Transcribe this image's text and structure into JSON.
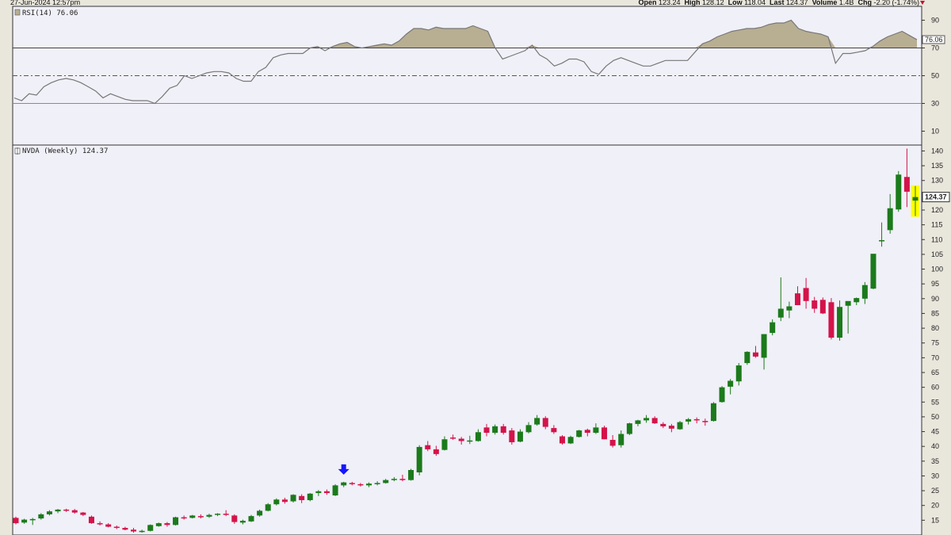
{
  "header": {
    "date": "27-Jun-2024 12:57pm",
    "open_label": "Open",
    "open": "123.24",
    "high_label": "High",
    "high": "128.12",
    "low_label": "Low",
    "low": "118.04",
    "last_label": "Last",
    "last": "124.37",
    "volume_label": "Volume",
    "volume": "1.4B",
    "chg_label": "Chg",
    "chg": "-2.20 (-1.74%)"
  },
  "colors": {
    "up": "#1b7a1b",
    "down": "#d4134a",
    "rsi_line": "#777777",
    "rsi_fill": "#b8ae92",
    "panel_bg": "#f0f0f8",
    "last_highlight": "#ffff00",
    "arrow": "#1515ff"
  },
  "chart_data": [
    {
      "type": "line",
      "title": "RSI(14) 76.06",
      "ylim": [
        0,
        100
      ],
      "yticks": [
        10,
        30,
        50,
        70,
        90
      ],
      "reference_lines": [
        30,
        50,
        70
      ],
      "last_value_label": "76.06",
      "values": [
        34,
        32,
        37,
        36,
        42,
        45,
        47,
        48,
        47,
        45,
        42,
        39,
        34,
        37,
        35,
        33,
        32,
        32,
        32,
        30,
        35,
        41,
        43,
        50,
        48,
        50,
        52,
        53,
        53,
        52,
        48,
        46,
        46,
        53,
        56,
        63,
        65,
        66,
        66,
        66,
        70,
        71,
        68,
        71,
        73,
        74,
        71,
        70,
        71,
        72,
        73,
        72,
        75,
        80,
        84,
        84,
        83,
        85,
        84,
        84,
        84,
        84,
        86,
        84,
        82,
        70,
        62,
        64,
        66,
        68,
        72,
        65,
        62,
        57,
        59,
        62,
        62,
        60,
        53,
        51,
        57,
        61,
        63,
        61,
        59,
        57,
        57,
        59,
        61,
        61,
        61,
        61,
        67,
        73,
        75,
        78,
        80,
        82,
        83,
        84,
        84,
        85,
        87,
        88,
        88,
        90,
        84,
        82,
        81,
        80,
        78,
        59,
        66,
        66,
        67,
        68,
        71,
        75,
        78,
        80,
        82,
        79,
        76
      ]
    },
    {
      "type": "candlestick",
      "title": "NVDA (Weekly) 124.37",
      "ylim": [
        10,
        142
      ],
      "yticks": [
        15,
        20,
        25,
        30,
        35,
        40,
        45,
        50,
        55,
        60,
        65,
        70,
        75,
        80,
        85,
        90,
        95,
        100,
        105,
        110,
        115,
        120,
        125,
        130,
        135,
        140
      ],
      "last_price_label": "124.37",
      "marker": {
        "type": "down-arrow",
        "index": 39
      },
      "ohlc": [
        [
          15.8,
          16.2,
          13.6,
          14.0
        ],
        [
          14.2,
          15.5,
          13.8,
          15.2
        ],
        [
          15.0,
          15.8,
          13.4,
          15.4
        ],
        [
          15.6,
          17.4,
          15.2,
          17.0
        ],
        [
          17.0,
          18.4,
          16.6,
          18.0
        ],
        [
          18.0,
          18.8,
          17.4,
          18.6
        ],
        [
          18.6,
          18.9,
          17.8,
          18.2
        ],
        [
          18.4,
          18.8,
          17.2,
          17.6
        ],
        [
          17.6,
          17.8,
          16.4,
          16.8
        ],
        [
          16.2,
          16.6,
          13.8,
          14.0
        ],
        [
          14.0,
          14.6,
          13.2,
          13.6
        ],
        [
          13.6,
          14.0,
          12.6,
          12.8
        ],
        [
          12.8,
          13.2,
          12.0,
          12.4
        ],
        [
          12.4,
          12.8,
          11.6,
          11.8
        ],
        [
          11.8,
          12.4,
          10.8,
          11.2
        ],
        [
          11.2,
          11.8,
          10.8,
          11.4
        ],
        [
          11.4,
          13.6,
          11.2,
          13.4
        ],
        [
          13.0,
          14.2,
          12.8,
          14.0
        ],
        [
          14.0,
          14.4,
          12.8,
          13.4
        ],
        [
          13.4,
          16.2,
          13.2,
          16.0
        ],
        [
          16.0,
          16.6,
          15.2,
          15.6
        ],
        [
          15.8,
          16.8,
          15.6,
          16.6
        ],
        [
          16.4,
          17.0,
          15.6,
          16.2
        ],
        [
          16.2,
          17.2,
          15.8,
          16.8
        ],
        [
          16.8,
          17.4,
          16.4,
          17.2
        ],
        [
          17.2,
          18.4,
          16.4,
          16.8
        ],
        [
          16.6,
          17.0,
          13.8,
          14.4
        ],
        [
          14.2,
          15.2,
          13.6,
          14.8
        ],
        [
          14.6,
          16.8,
          14.4,
          16.4
        ],
        [
          16.6,
          18.6,
          16.2,
          18.2
        ],
        [
          18.2,
          20.8,
          18.0,
          20.4
        ],
        [
          20.4,
          22.4,
          20.0,
          22.0
        ],
        [
          22.0,
          22.6,
          20.6,
          21.2
        ],
        [
          21.4,
          23.8,
          21.0,
          23.6
        ],
        [
          23.2,
          23.8,
          20.8,
          21.8
        ],
        [
          21.8,
          24.2,
          21.4,
          24.0
        ],
        [
          24.2,
          25.2,
          23.2,
          24.8
        ],
        [
          24.8,
          25.4,
          23.6,
          24.2
        ],
        [
          23.4,
          27.2,
          23.2,
          26.8
        ],
        [
          26.8,
          28.0,
          26.2,
          27.8
        ],
        [
          27.6,
          28.0,
          26.8,
          27.2
        ],
        [
          27.2,
          27.6,
          26.4,
          26.8
        ],
        [
          26.8,
          27.8,
          26.2,
          27.4
        ],
        [
          27.4,
          28.2,
          26.8,
          27.6
        ],
        [
          27.6,
          29.0,
          27.4,
          28.6
        ],
        [
          28.6,
          29.6,
          28.2,
          29.0
        ],
        [
          29.0,
          30.4,
          28.2,
          28.6
        ],
        [
          28.6,
          32.4,
          28.4,
          32.0
        ],
        [
          31.2,
          40.4,
          30.2,
          39.8
        ],
        [
          40.4,
          41.8,
          38.4,
          39.0
        ],
        [
          39.0,
          40.2,
          36.8,
          37.4
        ],
        [
          38.8,
          43.4,
          38.6,
          42.4
        ],
        [
          43.0,
          44.0,
          42.2,
          42.6
        ],
        [
          42.6,
          43.2,
          40.6,
          41.8
        ],
        [
          42.0,
          43.6,
          40.8,
          42.0
        ],
        [
          41.8,
          45.8,
          41.6,
          44.8
        ],
        [
          46.4,
          47.6,
          43.4,
          44.6
        ],
        [
          44.6,
          47.4,
          44.0,
          46.8
        ],
        [
          46.8,
          47.6,
          44.0,
          44.6
        ],
        [
          45.4,
          46.2,
          40.6,
          41.4
        ],
        [
          41.6,
          45.8,
          41.4,
          45.0
        ],
        [
          44.8,
          48.2,
          44.4,
          47.2
        ],
        [
          47.4,
          50.6,
          47.0,
          49.6
        ],
        [
          49.6,
          50.2,
          45.8,
          46.6
        ],
        [
          46.2,
          47.2,
          44.2,
          44.8
        ],
        [
          43.4,
          43.8,
          40.6,
          41.0
        ],
        [
          41.0,
          43.6,
          40.8,
          43.2
        ],
        [
          43.2,
          45.6,
          43.0,
          45.4
        ],
        [
          45.6,
          46.0,
          43.4,
          44.6
        ],
        [
          44.6,
          47.8,
          44.2,
          46.4
        ],
        [
          46.4,
          47.0,
          42.4,
          42.4
        ],
        [
          42.2,
          43.8,
          39.6,
          40.2
        ],
        [
          40.4,
          45.4,
          39.6,
          44.2
        ],
        [
          44.2,
          48.0,
          43.8,
          47.8
        ],
        [
          47.6,
          49.0,
          46.8,
          48.8
        ],
        [
          48.8,
          50.6,
          48.0,
          49.6
        ],
        [
          49.6,
          50.2,
          47.6,
          47.8
        ],
        [
          47.6,
          48.2,
          46.2,
          46.8
        ],
        [
          47.0,
          47.6,
          44.8,
          46.0
        ],
        [
          45.8,
          48.6,
          45.6,
          48.2
        ],
        [
          48.4,
          49.6,
          47.4,
          49.2
        ],
        [
          49.2,
          49.8,
          47.8,
          48.8
        ],
        [
          48.6,
          49.4,
          47.0,
          48.2
        ],
        [
          48.6,
          55.0,
          48.4,
          54.6
        ],
        [
          55.0,
          60.4,
          54.8,
          60.0
        ],
        [
          60.2,
          62.8,
          57.6,
          62.2
        ],
        [
          62.0,
          68.2,
          60.6,
          67.4
        ],
        [
          68.2,
          72.2,
          67.6,
          72.0
        ],
        [
          71.8,
          74.0,
          70.0,
          70.4
        ],
        [
          70.0,
          78.0,
          66.0,
          78.0
        ],
        [
          78.4,
          83.0,
          77.6,
          82.0
        ],
        [
          83.6,
          97.2,
          82.4,
          86.6
        ],
        [
          86.0,
          89.0,
          83.4,
          87.4
        ],
        [
          91.8,
          94.2,
          88.2,
          87.8
        ],
        [
          93.6,
          97.0,
          86.6,
          89.2
        ],
        [
          89.4,
          90.6,
          85.2,
          86.6
        ],
        [
          89.6,
          90.4,
          84.8,
          85.0
        ],
        [
          88.8,
          90.2,
          76.2,
          76.8
        ],
        [
          76.8,
          89.4,
          75.8,
          87.2
        ],
        [
          87.6,
          88.6,
          78.2,
          89.2
        ],
        [
          88.8,
          90.4,
          87.8,
          90.2
        ],
        [
          90.0,
          95.6,
          88.2,
          94.6
        ],
        [
          93.4,
          104.2,
          93.2,
          105.2
        ],
        [
          109.8,
          115.8,
          107.6,
          109.8
        ],
        [
          113.2,
          125.4,
          112.0,
          120.6
        ],
        [
          120.2,
          133.2,
          119.4,
          132.0
        ],
        [
          131.2,
          140.8,
          121.0,
          126.2
        ],
        [
          123.2,
          128.1,
          118.0,
          124.4
        ]
      ]
    }
  ]
}
